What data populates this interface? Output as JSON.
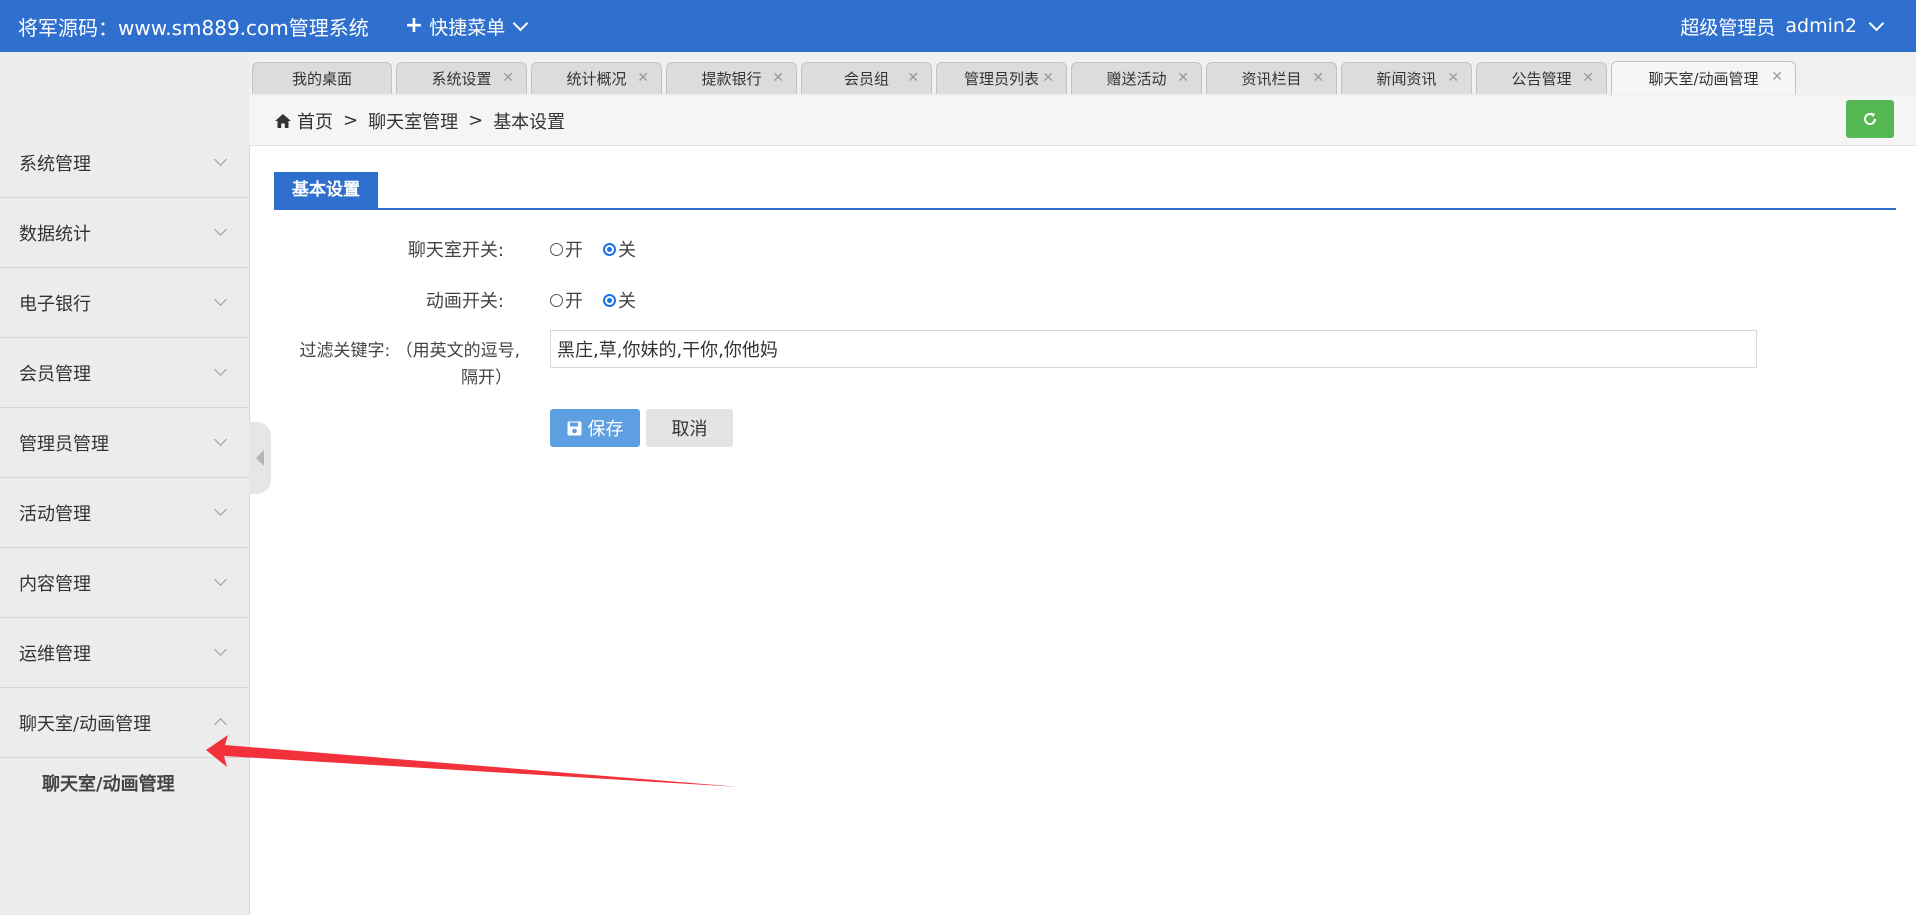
{
  "header": {
    "brand": "将军源码：www.sm889.com管理系统",
    "quick_menu": "快捷菜单",
    "user_role": "超级管理员",
    "username": "admin2"
  },
  "sidebar": {
    "items": [
      {
        "label": "系统管理"
      },
      {
        "label": "数据统计"
      },
      {
        "label": "电子银行"
      },
      {
        "label": "会员管理"
      },
      {
        "label": "管理员管理"
      },
      {
        "label": "活动管理"
      },
      {
        "label": "内容管理"
      },
      {
        "label": "运维管理"
      },
      {
        "label": "聊天室/动画管理"
      }
    ],
    "sub_item": "聊天室/动画管理"
  },
  "tabs": [
    {
      "label": "我的桌面"
    },
    {
      "label": "系统设置"
    },
    {
      "label": "统计概况"
    },
    {
      "label": "提款银行"
    },
    {
      "label": "会员组"
    },
    {
      "label": "管理员列表"
    },
    {
      "label": "赠送活动"
    },
    {
      "label": "资讯栏目"
    },
    {
      "label": "新闻资讯"
    },
    {
      "label": "公告管理"
    },
    {
      "label": "聊天室/动画管理"
    }
  ],
  "breadcrumb": {
    "home": "首页",
    "level1": "聊天室管理",
    "level2": "基本设置",
    "sep": ">"
  },
  "section_title": "基本设置",
  "form": {
    "chatroom_label": "聊天室开关:",
    "animation_label": "动画开关:",
    "filter_label_line1": "过滤关键字: （用英文的逗号,",
    "filter_label_line2": "隔开）",
    "radio_on": "开",
    "radio_off": "关",
    "chatroom_value": "关",
    "animation_value": "关",
    "filter_value": "黑庄,草,你妹的,干你,你他妈"
  },
  "buttons": {
    "save": "保存",
    "cancel": "取消"
  },
  "colors": {
    "header_bg": "#2f6fce",
    "accent": "#2f6fce",
    "save_btn": "#5d9fe0",
    "refresh_btn": "#55b855",
    "arrow": "#f2313a"
  }
}
